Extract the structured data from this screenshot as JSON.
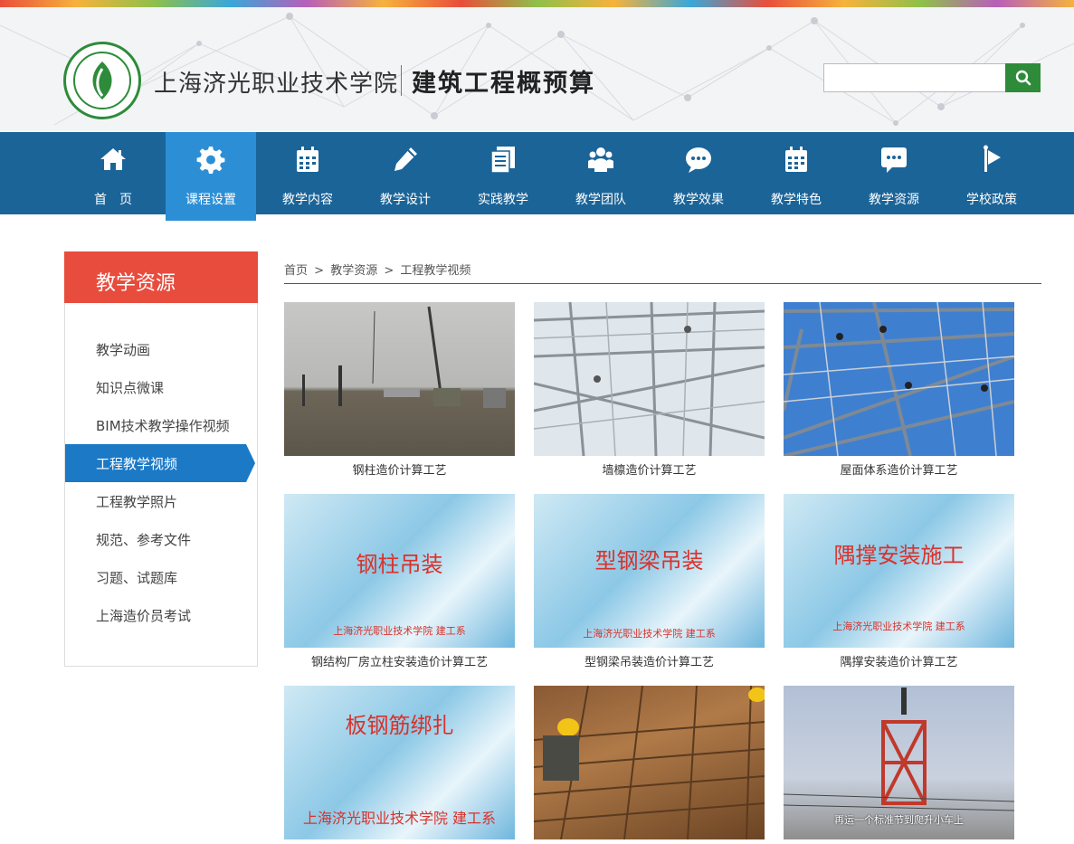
{
  "header": {
    "school_name": "上海济光职业技术学院",
    "course_name": "建筑工程概预算",
    "search": {
      "value": "",
      "placeholder": ""
    },
    "colors": {
      "nav": "#1b6498",
      "nav_active": "#2c8fd6",
      "search_button": "#2e8b3a"
    }
  },
  "nav": {
    "items": [
      {
        "label": "首　页",
        "icon": "home-icon"
      },
      {
        "label": "课程设置",
        "icon": "gear-icon",
        "active": true
      },
      {
        "label": "教学内容",
        "icon": "calendar-icon"
      },
      {
        "label": "教学设计",
        "icon": "pencil-icon"
      },
      {
        "label": "实践教学",
        "icon": "document-icon"
      },
      {
        "label": "教学团队",
        "icon": "team-icon"
      },
      {
        "label": "教学效果",
        "icon": "chat-bubble-icon"
      },
      {
        "label": "教学特色",
        "icon": "calendar-icon"
      },
      {
        "label": "教学资源",
        "icon": "message-icon"
      },
      {
        "label": "学校政策",
        "icon": "flag-icon"
      }
    ]
  },
  "sidebar": {
    "title": "教学资源",
    "items": [
      {
        "label": "教学动画"
      },
      {
        "label": "知识点微课"
      },
      {
        "label": "BIM技术教学操作视频"
      },
      {
        "label": "工程教学视频",
        "active": true
      },
      {
        "label": "工程教学照片"
      },
      {
        "label": "规范、参考文件"
      },
      {
        "label": "习题、试题库"
      },
      {
        "label": "上海造价员考试"
      }
    ],
    "colors": {
      "head": "#e84c3d",
      "active": "#1b79c6"
    }
  },
  "breadcrumb": {
    "home": "首页",
    "sep1": ">",
    "section": "教学资源",
    "sep2": ">",
    "current": "工程教学视频"
  },
  "videos": [
    {
      "caption": "钢柱造价计算工艺"
    },
    {
      "caption": "墙檩造价计算工艺"
    },
    {
      "caption": "屋面体系造价计算工艺"
    },
    {
      "caption": "钢结构厂房立柱安装造价计算工艺",
      "thumb_title": "钢柱吊装",
      "thumb_sub": "上海济光职业技术学院  建工系"
    },
    {
      "caption": "型钢梁吊装造价计算工艺",
      "thumb_title": "型钢梁吊装",
      "thumb_sub": "上海济光职业技术学院  建工系"
    },
    {
      "caption": "隅撑安装造价计算工艺",
      "thumb_title": "隅撑安装施工",
      "thumb_sub": "上海济光职业技术学院  建工系"
    },
    {
      "caption": "",
      "thumb_title": "板钢筋绑扎",
      "thumb_sub": "上海济光职业技术学院 建工系"
    },
    {
      "caption": ""
    },
    {
      "caption": "",
      "thumb_sub": "再运一个标准节到爬升小车上"
    }
  ]
}
